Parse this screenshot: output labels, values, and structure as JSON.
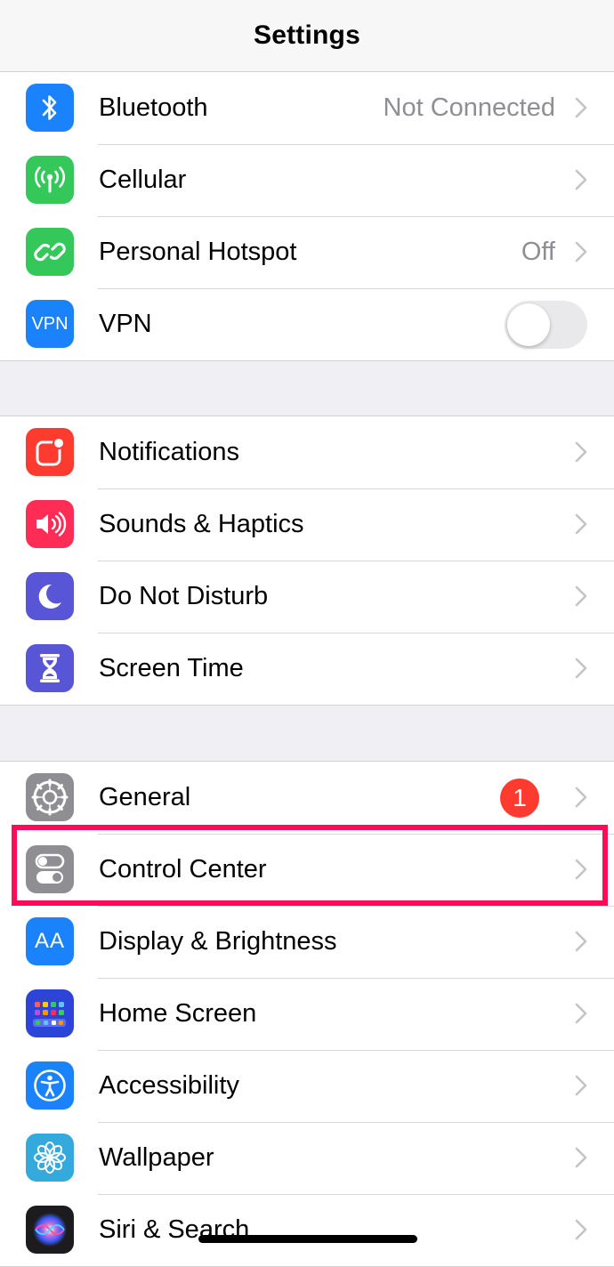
{
  "nav": {
    "title": "Settings"
  },
  "colors": {
    "background": "#efeff4",
    "highlight": "#ff0a5a",
    "badge": "#ff3b30",
    "secondary_text": "#8e8e93"
  },
  "groups": [
    {
      "rows": [
        {
          "label": "Bluetooth",
          "value": "Not Connected",
          "icon": "bluetooth-icon",
          "icon_color": "#1a82fb"
        },
        {
          "label": "Cellular",
          "icon": "antenna-icon",
          "icon_color": "#34c759"
        },
        {
          "label": "Personal Hotspot",
          "value": "Off",
          "icon": "hotspot-link-icon",
          "icon_color": "#34c759"
        },
        {
          "label": "VPN",
          "icon": "vpn-icon",
          "icon_text": "VPN",
          "icon_color": "#1a82fb",
          "toggle_on": false
        }
      ]
    },
    {
      "rows": [
        {
          "label": "Notifications",
          "icon": "notifications-icon",
          "icon_color": "#ff3b30"
        },
        {
          "label": "Sounds & Haptics",
          "icon": "speaker-icon",
          "icon_color": "#ff2d55"
        },
        {
          "label": "Do Not Disturb",
          "icon": "moon-icon",
          "icon_color": "#5856d6"
        },
        {
          "label": "Screen Time",
          "icon": "hourglass-icon",
          "icon_color": "#5856d6"
        }
      ]
    },
    {
      "rows": [
        {
          "label": "General",
          "icon": "gear-icon",
          "icon_color": "#8e8e93",
          "badge": "1"
        },
        {
          "label": "Control Center",
          "icon": "switches-icon",
          "icon_color": "#8e8e93"
        },
        {
          "label": "Display & Brightness",
          "icon": "text-size-icon",
          "icon_text": "AA",
          "icon_color": "#1a82fb"
        },
        {
          "label": "Home Screen",
          "icon": "app-grid-icon",
          "icon_color": "#2c44d8"
        },
        {
          "label": "Accessibility",
          "icon": "accessibility-icon",
          "icon_color": "#1a82fb"
        },
        {
          "label": "Wallpaper",
          "icon": "flower-icon",
          "icon_color": "#34aadc"
        },
        {
          "label": "Siri & Search",
          "icon": "siri-icon",
          "icon_color": "#1c1c1e"
        }
      ]
    }
  ]
}
